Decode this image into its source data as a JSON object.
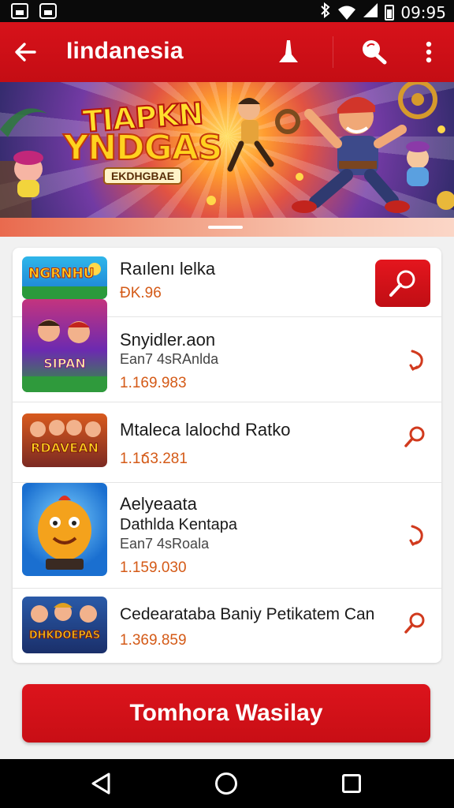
{
  "status_bar": {
    "time": "09:95",
    "icons": [
      "image-icon",
      "download-icon",
      "bluetooth-icon",
      "wifi-icon",
      "signal-icon",
      "battery-icon"
    ]
  },
  "app_bar": {
    "title": "Iindanesia",
    "actions": [
      "back-arrow-icon",
      "pin-icon",
      "search-icon",
      "more-vert-icon"
    ]
  },
  "banner": {
    "title_line1": "TIAPKN",
    "title_line2": "YNDGAS",
    "subtitle": "EKDHGBAE"
  },
  "list": {
    "items": [
      {
        "title": "Raılenı lelka",
        "price": "ƉK.96",
        "action_icon": "search-icon"
      },
      {
        "title": "Snyidler.aon",
        "subtitle": "Ean7 4sRAnlda",
        "price": "1.169.983",
        "action_icon": "curved-arrow-icon"
      },
      {
        "title": "Mtaleca lalochd Ratko",
        "price": "1.1ճ3.281",
        "action_icon": "search-icon"
      },
      {
        "title": "Aelyeaata",
        "subtitle": "Dathlda Kentapa",
        "subtitle2": "Ean7 4sRoala",
        "price": "1.159.030",
        "action_icon": "curved-arrow-icon"
      },
      {
        "title": "Cedearataba Baniy Petikatem Can",
        "price": "1.369.859",
        "action_icon": "search-icon"
      }
    ],
    "thumb_labels": [
      "NGRNHU",
      "SIPAN",
      "RDAVEAN",
      "",
      "DHKDOEPAS"
    ]
  },
  "cta": {
    "label": "Tomhora Wasilay"
  },
  "colors": {
    "primary_red": "#d7121a",
    "price_orange": "#d45a17",
    "background": "#f1f1f1"
  },
  "nav_bar": {
    "buttons": [
      "back-triangle-icon",
      "home-circle-icon",
      "recent-square-icon"
    ]
  }
}
